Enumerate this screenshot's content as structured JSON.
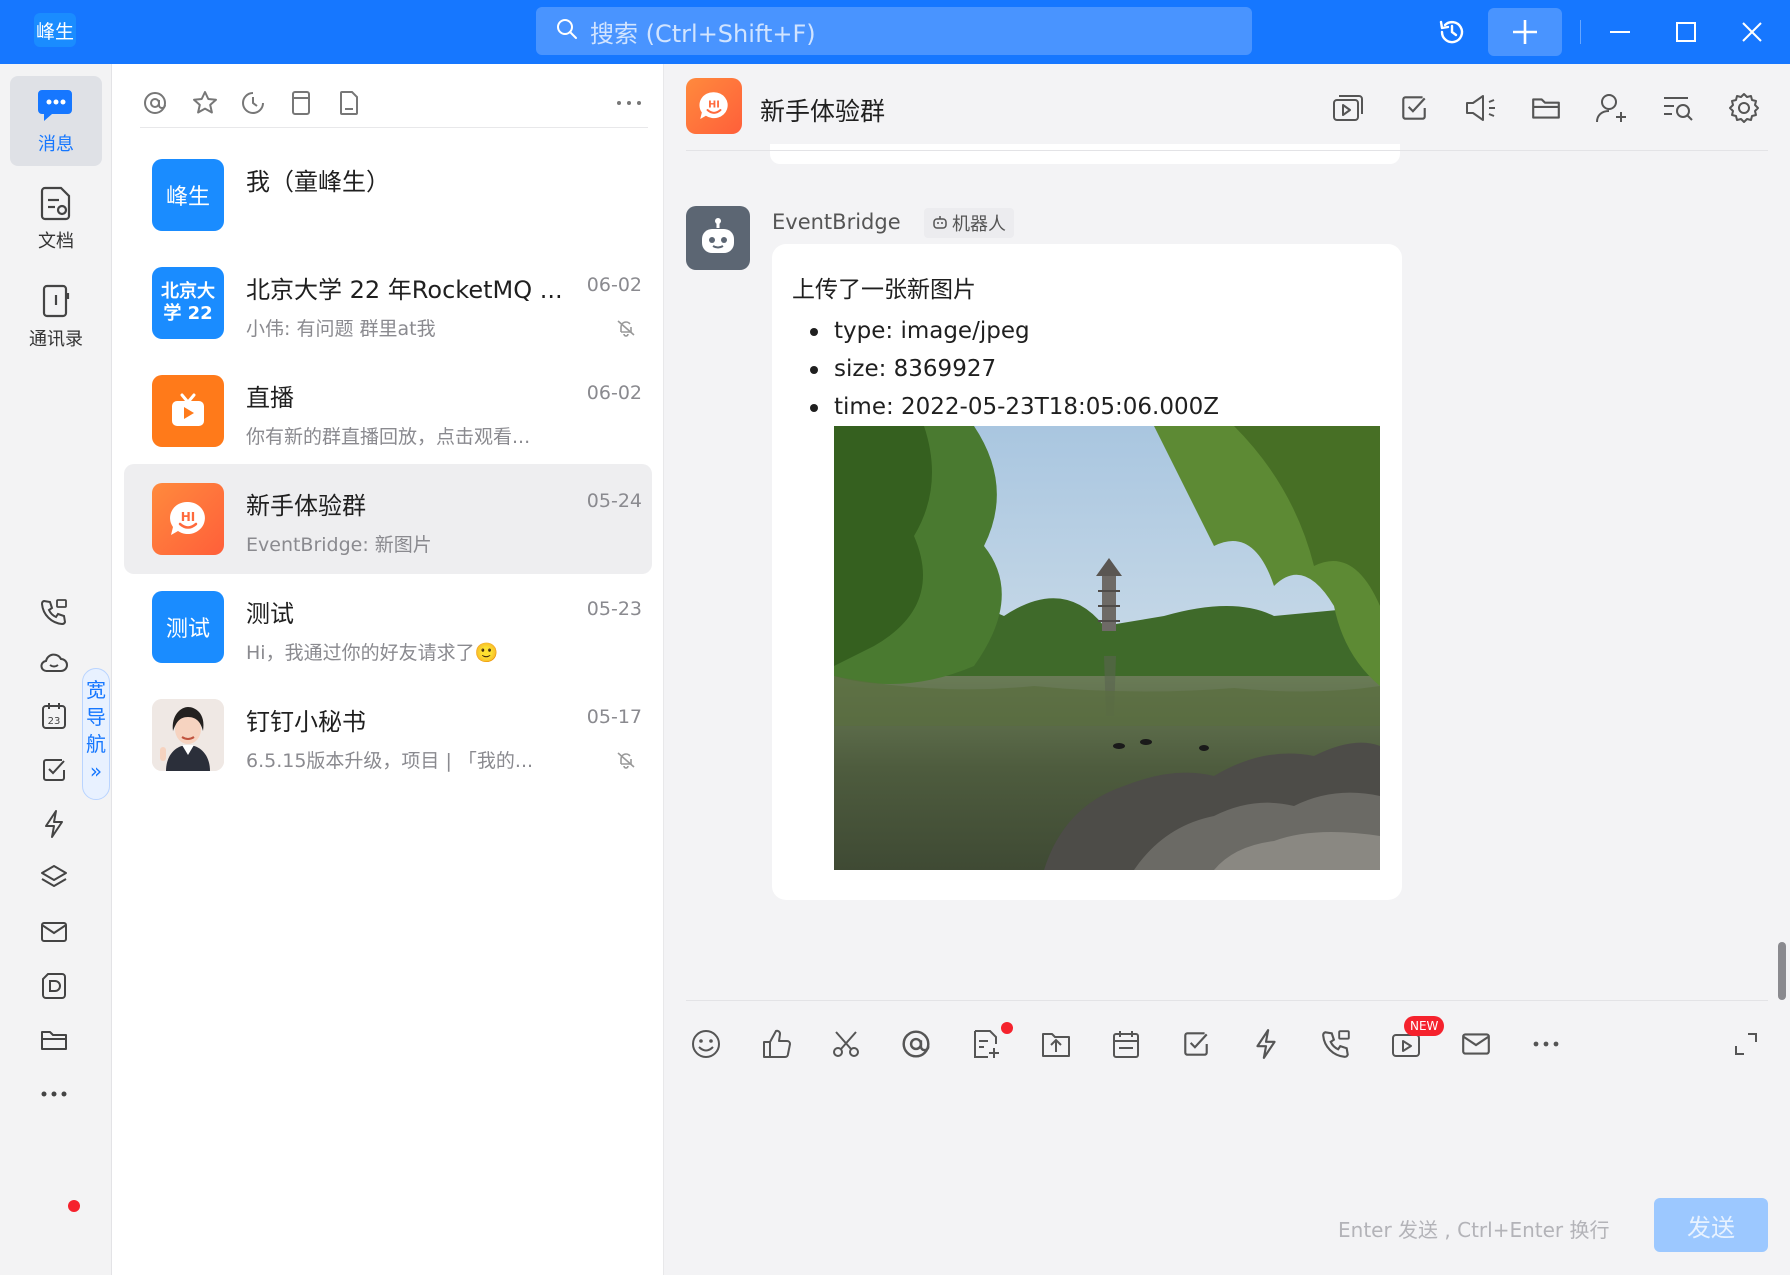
{
  "titlebar": {
    "user_avatar": "峰生",
    "search_placeholder": "搜索 (Ctrl+Shift+F)"
  },
  "nav": {
    "items": [
      {
        "label": "消息",
        "icon": "message-icon",
        "active": true
      },
      {
        "label": "文档",
        "icon": "document-icon"
      },
      {
        "label": "通讯录",
        "icon": "contacts-icon"
      }
    ],
    "wide_nav_label": "宽导航",
    "wide_nav_chevron": "»",
    "small_icons": [
      "phone-icon",
      "cloud-icon",
      "calendar-icon",
      "todo-icon",
      "lightning-icon",
      "workbench-icon",
      "mail-icon",
      "docs-d-icon",
      "folder-icon",
      "more-icon"
    ],
    "calendar_day": "23"
  },
  "conversations": [
    {
      "name": "我（童峰生）",
      "preview": "",
      "date": "",
      "avatar_text": "峰生",
      "avatar_color": "#1a8cff",
      "muted": false
    },
    {
      "name": "北京大学 22 年RocketMQ ...",
      "preview": "小伟: 有问题 群里at我",
      "date": "06-02",
      "avatar_text": "北京大学 22",
      "avatar_color": "#1a8cff",
      "muted": true
    },
    {
      "name": "直播",
      "preview": "你有新的群直播回放，点击观看...",
      "date": "06-02",
      "avatar_text": "",
      "avatar_color": "#ff7a1a",
      "muted": false
    },
    {
      "name": "新手体验群",
      "preview": "EventBridge: 新图片",
      "date": "05-24",
      "avatar_text": "",
      "avatar_color": "#ff6a3d",
      "muted": false,
      "active": true
    },
    {
      "name": "测试",
      "preview": "Hi，我通过你的好友请求了🙂",
      "date": "05-23",
      "avatar_text": "测试",
      "avatar_color": "#1a8cff",
      "muted": false
    },
    {
      "name": "钉钉小秘书",
      "preview": "6.5.15版本升级，项目 | 「我的...",
      "date": "05-17",
      "avatar_text": "",
      "avatar_color": "#f2e6df",
      "muted": true
    }
  ],
  "chat": {
    "title": "新手体验群",
    "sender": "EventBridge",
    "badge": "机器人",
    "message": {
      "headline": "上传了一张新图片",
      "items": [
        "type: image/jpeg",
        "size: 8369927",
        "time: 2022-05-23T18:05:06.000Z"
      ]
    },
    "avatar_hi": "HI",
    "new_badge": "NEW",
    "send_hint": "Enter 发送 , Ctrl+Enter 换行",
    "send_label": "发送"
  },
  "colors": {
    "brand": "#1677ff",
    "badge_red": "#f5222d",
    "send_disabled": "#9cc8ff"
  }
}
